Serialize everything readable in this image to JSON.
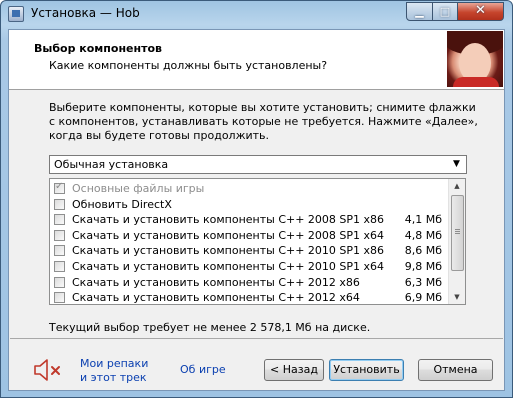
{
  "window": {
    "title": "Установка — Hob"
  },
  "titlebar": {
    "minimize_glyph": "▁",
    "maximize_glyph": "□",
    "close_glyph": "✕"
  },
  "header": {
    "title": "Выбор компонентов",
    "subtitle": "Какие компоненты должны быть установлены?"
  },
  "description": "Выберите компоненты, которые вы хотите установить; снимите флажки с компонентов, устанавливать которые не требуется. Нажмите «Далее», когда вы будете готовы продолжить.",
  "install_type": {
    "selected": "Обычная установка",
    "arrow": "▼"
  },
  "components": [
    {
      "label": "Основные файлы игры",
      "size": "",
      "checked": true,
      "disabled": true
    },
    {
      "label": "Обновить DirectX",
      "size": "",
      "checked": false,
      "disabled": false
    },
    {
      "label": "Скачать и установить компоненты C++ 2008 SP1 x86",
      "size": "4,1 Мб",
      "checked": false,
      "disabled": false
    },
    {
      "label": "Скачать и установить компоненты C++ 2008 SP1 x64",
      "size": "4,8 Мб",
      "checked": false,
      "disabled": false
    },
    {
      "label": "Скачать и установить компоненты C++ 2010 SP1 x86",
      "size": "8,6 Мб",
      "checked": false,
      "disabled": false
    },
    {
      "label": "Скачать и установить компоненты C++ 2010 SP1 x64",
      "size": "9,8 Мб",
      "checked": false,
      "disabled": false
    },
    {
      "label": "Скачать и установить компоненты C++ 2012 x86",
      "size": "6,3 Мб",
      "checked": false,
      "disabled": false
    },
    {
      "label": "Скачать и установить компоненты C++ 2012 x64",
      "size": "6,9 Мб",
      "checked": false,
      "disabled": false
    }
  ],
  "scrollbar": {
    "up": "▲",
    "down": "▼"
  },
  "space_required": "Текущий выбор требует не менее 2 578,1 Мб на диске.",
  "footer": {
    "link_repacks_line1": "Мои репаки",
    "link_repacks_line2": "и этот трек",
    "link_about": "Об игре",
    "back_label": "< Назад",
    "install_label": "Установить",
    "cancel_label": "Отмена"
  },
  "colors": {
    "link": "#0a3fb0",
    "speaker_red": "#c0392b"
  }
}
